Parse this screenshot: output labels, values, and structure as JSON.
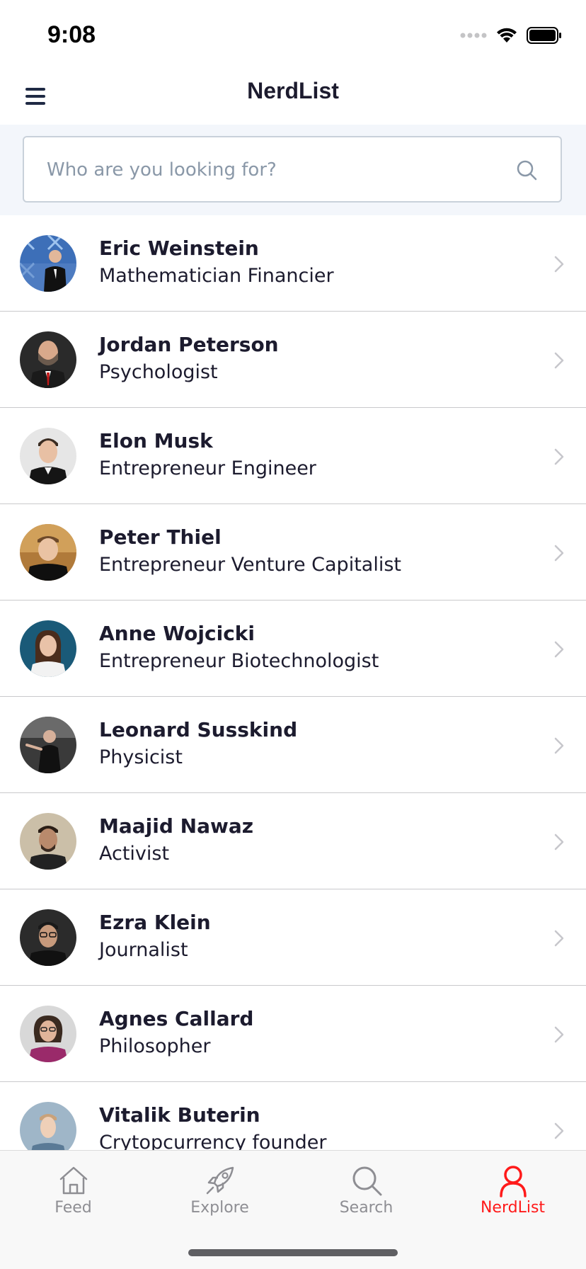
{
  "status_bar": {
    "time": "9:08"
  },
  "nav": {
    "title": "NerdList",
    "menu_icon": "hamburger-menu-icon"
  },
  "search": {
    "placeholder": "Who are you looking for?",
    "value": "",
    "icon": "search-icon"
  },
  "people": [
    {
      "name": "Eric Weinstein",
      "description": "Mathematician Financier"
    },
    {
      "name": "Jordan Peterson",
      "description": "Psychologist"
    },
    {
      "name": "Elon Musk",
      "description": "Entrepreneur Engineer"
    },
    {
      "name": "Peter Thiel",
      "description": "Entrepreneur Venture Capitalist"
    },
    {
      "name": "Anne Wojcicki",
      "description": "Entrepreneur Biotechnologist"
    },
    {
      "name": "Leonard Susskind",
      "description": "Physicist"
    },
    {
      "name": "Maajid Nawaz",
      "description": "Activist"
    },
    {
      "name": "Ezra Klein",
      "description": "Journalist"
    },
    {
      "name": "Agnes Callard",
      "description": "Philosopher"
    },
    {
      "name": "Vitalik Buterin",
      "description": "Crytopcurrency founder"
    }
  ],
  "tabs": [
    {
      "label": "Feed",
      "icon": "home-icon",
      "active": false
    },
    {
      "label": "Explore",
      "icon": "rocket-icon",
      "active": false
    },
    {
      "label": "Search",
      "icon": "search-icon",
      "active": false
    },
    {
      "label": "NerdList",
      "icon": "person-icon",
      "active": true
    }
  ],
  "colors": {
    "accent": "#ff1a1a",
    "inactive_tab": "#8e8e93",
    "search_background": "#f3f6fb",
    "text": "#1c1b2e"
  }
}
